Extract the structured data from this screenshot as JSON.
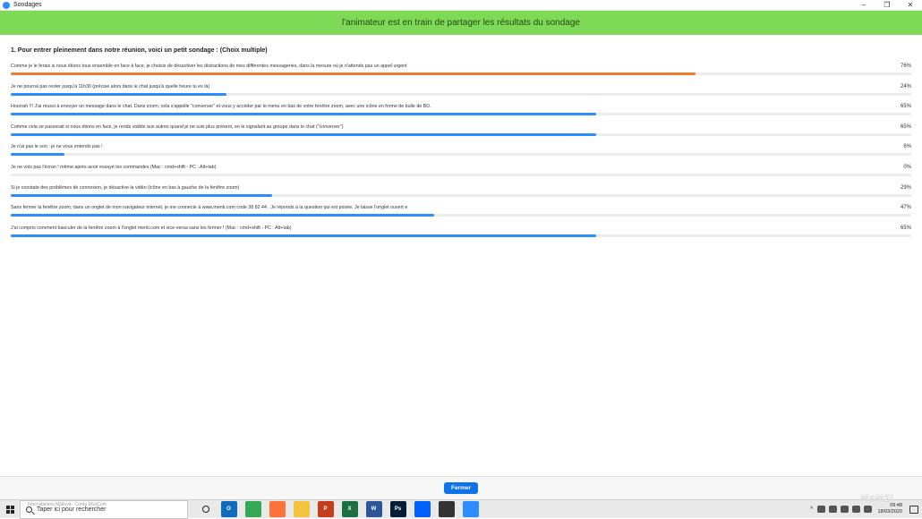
{
  "window": {
    "title": "Sondages"
  },
  "banner": {
    "text": "l'animateur est en train de partager les résultats du sondage"
  },
  "poll": {
    "question": "1. Pour entrer pleinement dans notre réunion, voici un petit sondage : (Choix multiple)",
    "answers": [
      {
        "text": "Comme je le ferais si nous étions tous ensemble en face à face, je choisis de désactiver les distractions de mes différentes messageries, dans la mesure où je n'attends pas un appel urgent",
        "percent_label": "76%",
        "percent": 76,
        "color": "#f07b2c"
      },
      {
        "text": "Je ne pourrai pas rester jusqu'à 11h30 (précise alors dans le chat jusqu'à quelle heure tu es là)",
        "percent_label": "24%",
        "percent": 24,
        "color": "#2d8cff"
      },
      {
        "text": "Hourrah !!! J'ai réussi à envoyer un message dans le chat. Dans zoom, cela s'appelle \"converser\" et vous y accéder par le menu en bas de votre fenêtre zoom, avec une icône en forme de bulle de BD.",
        "percent_label": "65%",
        "percent": 65,
        "color": "#2d8cff"
      },
      {
        "text": "Comme cela se passerait si nous étions en face, je rends visible aux autres quand je ne suis plus présent, en le signalant au groupe dans le chat (\"converser\")",
        "percent_label": "65%",
        "percent": 65,
        "color": "#2d8cff"
      },
      {
        "text": "Je n'ai pas le son : je ne vous entends pas !",
        "percent_label": "6%",
        "percent": 6,
        "color": "#2d8cff"
      },
      {
        "text": "Je ne vois pas l'écran ! même après avoir essayé les commandes (Mac : cmd+shift - PC : Alt+tab)",
        "percent_label": "0%",
        "percent": 0,
        "color": "#2d8cff"
      },
      {
        "text": "Si je constate des problèmes de connexion, je désactive la vidéo (icône en bas à gauche de la fenêtre zoom)",
        "percent_label": "29%",
        "percent": 29,
        "color": "#2d8cff"
      },
      {
        "text": "Sans fermer la fenêtre zoom, dans un onglet de mon navigateur internet, je me connecte à www.menti.com code 38 82 44 . Je réponds à la question qui est posée. Je laisse l'onglet ouvert e",
        "percent_label": "47%",
        "percent": 47,
        "color": "#2d8cff"
      },
      {
        "text": "J'ai compris comment basculer de la fenêtre zoom à l'onglet menti.com et vice-versa sans les fermer ! (Mac : cmd+shift - PC : Alt+tab)",
        "percent_label": "65%",
        "percent": 65,
        "color": "#2d8cff"
      }
    ]
  },
  "footer": {
    "close_label": "Fermer"
  },
  "taskbar": {
    "search_placeholder": "Taper ici pour rechercher",
    "search_ghost": "Intercalations Mallevit - Corda DivyCom",
    "apps": [
      {
        "name": "outlook-icon",
        "color": "#0f6cbd",
        "glyph": "O"
      },
      {
        "name": "chrome-icon",
        "color": "#34a853",
        "glyph": ""
      },
      {
        "name": "firefox-icon",
        "color": "#ff7139",
        "glyph": ""
      },
      {
        "name": "file-explorer-icon",
        "color": "#f3c53e",
        "glyph": ""
      },
      {
        "name": "powerpoint-icon",
        "color": "#c43e1c",
        "glyph": "P"
      },
      {
        "name": "excel-icon",
        "color": "#1d6f42",
        "glyph": "X"
      },
      {
        "name": "word-icon",
        "color": "#2b579a",
        "glyph": "W"
      },
      {
        "name": "photoshop-icon",
        "color": "#001e36",
        "glyph": "Ps"
      },
      {
        "name": "dropbox-icon",
        "color": "#0061ff",
        "glyph": ""
      },
      {
        "name": "photos-icon",
        "color": "#333333",
        "glyph": ""
      },
      {
        "name": "zoom-icon",
        "color": "#2d8cff",
        "glyph": ""
      }
    ],
    "time": "09:48",
    "date": "18/03/2020"
  },
  "watermark": "MoMZi"
}
